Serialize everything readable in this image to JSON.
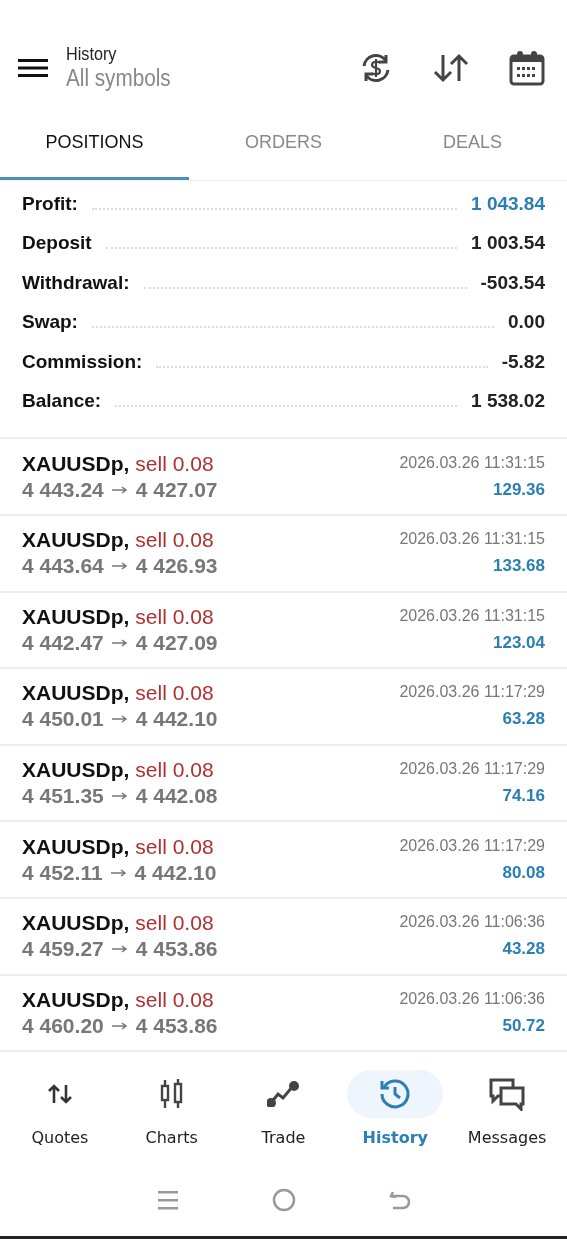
{
  "header": {
    "title": "History",
    "subtitle": "All symbols"
  },
  "tabs": [
    {
      "label": "POSITIONS",
      "selected": true
    },
    {
      "label": "ORDERS",
      "selected": false
    },
    {
      "label": "DEALS",
      "selected": false
    }
  ],
  "summary": [
    {
      "label": "Profit:",
      "value": "1 043.84",
      "highlighted": true
    },
    {
      "label": "Deposit",
      "value": "1 003.54",
      "highlighted": false
    },
    {
      "label": "Withdrawal:",
      "value": "-503.54",
      "highlighted": false
    },
    {
      "label": "Swap:",
      "value": "0.00",
      "highlighted": false
    },
    {
      "label": "Commission:",
      "value": "-5.82",
      "highlighted": false
    },
    {
      "label": "Balance:",
      "value": "1 538.02",
      "highlighted": false
    }
  ],
  "positions": [
    {
      "symbol": "XAUUSDp,",
      "side": "sell 0.08",
      "open": "4 443.24",
      "close": "4 427.07",
      "time": "2026.03.26 11:31:15",
      "profit": "129.36"
    },
    {
      "symbol": "XAUUSDp,",
      "side": "sell 0.08",
      "open": "4 443.64",
      "close": "4 426.93",
      "time": "2026.03.26 11:31:15",
      "profit": "133.68"
    },
    {
      "symbol": "XAUUSDp,",
      "side": "sell 0.08",
      "open": "4 442.47",
      "close": "4 427.09",
      "time": "2026.03.26 11:31:15",
      "profit": "123.04"
    },
    {
      "symbol": "XAUUSDp,",
      "side": "sell 0.08",
      "open": "4 450.01",
      "close": "4 442.10",
      "time": "2026.03.26 11:17:29",
      "profit": "63.28"
    },
    {
      "symbol": "XAUUSDp,",
      "side": "sell 0.08",
      "open": "4 451.35",
      "close": "4 442.08",
      "time": "2026.03.26 11:17:29",
      "profit": "74.16"
    },
    {
      "symbol": "XAUUSDp,",
      "side": "sell 0.08",
      "open": "4 452.11",
      "close": "4 442.10",
      "time": "2026.03.26 11:17:29",
      "profit": "80.08"
    },
    {
      "symbol": "XAUUSDp,",
      "side": "sell 0.08",
      "open": "4 459.27",
      "close": "4 453.86",
      "time": "2026.03.26 11:06:36",
      "profit": "43.28"
    },
    {
      "symbol": "XAUUSDp,",
      "side": "sell 0.08",
      "open": "4 460.20",
      "close": "4 453.86",
      "time": "2026.03.26 11:06:36",
      "profit": "50.72"
    }
  ],
  "bottom_nav": [
    {
      "label": "Quotes",
      "selected": false
    },
    {
      "label": "Charts",
      "selected": false
    },
    {
      "label": "Trade",
      "selected": false
    },
    {
      "label": "History",
      "selected": true
    },
    {
      "label": "Messages",
      "selected": false
    }
  ]
}
